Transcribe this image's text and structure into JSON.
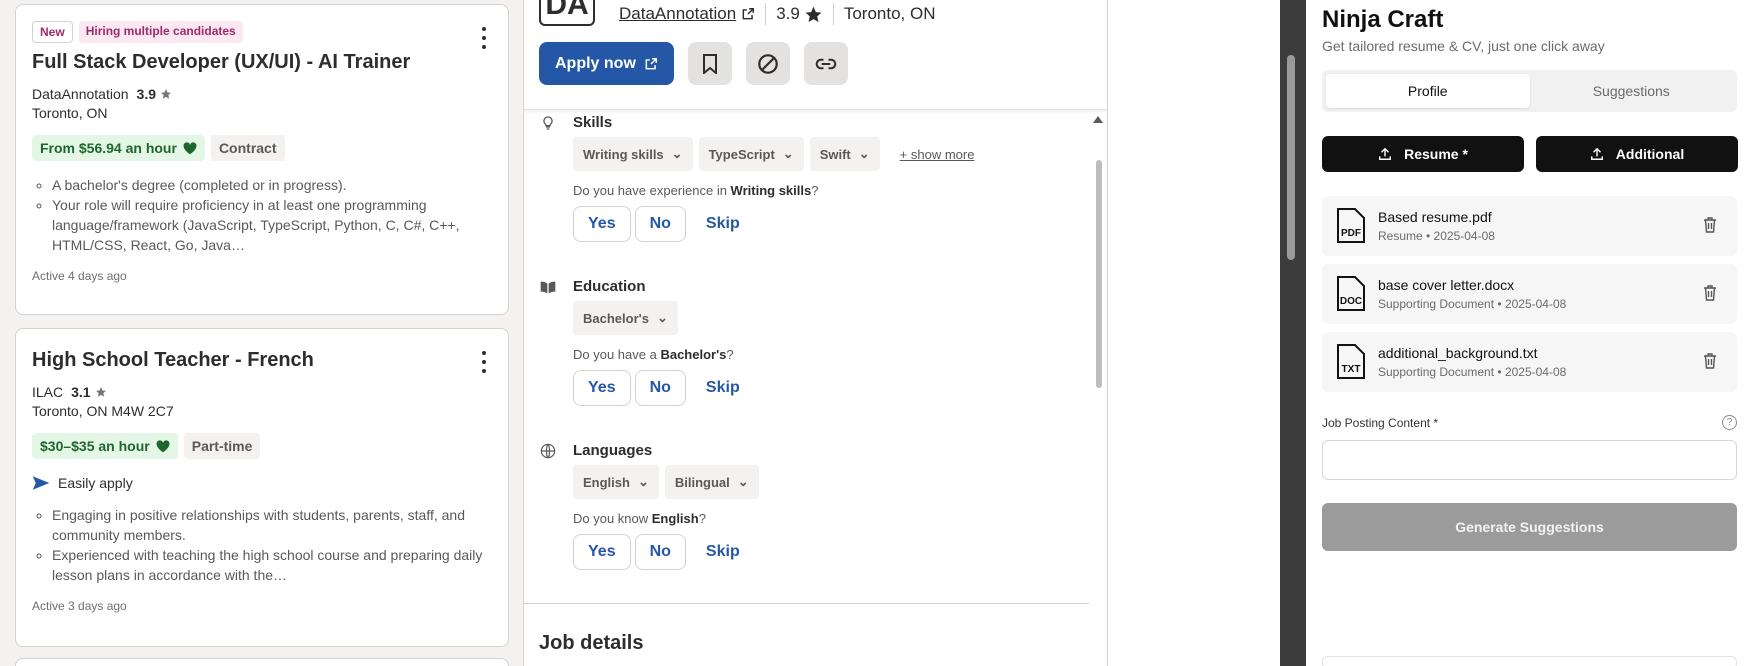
{
  "job_list": {
    "cards": [
      {
        "badges": [
          "New",
          "Hiring multiple candidates"
        ],
        "title": "Full Stack Developer (UX/UI) - AI Trainer",
        "company": "DataAnnotation",
        "rating": "3.9",
        "location": "Toronto, ON",
        "pay": "From $56.94 an hour",
        "job_type": "Contract",
        "bullets": [
          "A bachelor's degree (completed or in progress).",
          "Your role will require proficiency in at least one programming language/framework (JavaScript, TypeScript, Python, C, C#, C++, HTML/CSS, React, Go, Java…"
        ],
        "active": "Active 4 days ago"
      },
      {
        "title": "High School Teacher - French",
        "company": "ILAC",
        "rating": "3.1",
        "location": "Toronto, ON M4W 2C7",
        "pay": "$30–$35 an hour",
        "job_type": "Part-time",
        "easy_apply": "Easily apply",
        "bullets": [
          "Engaging in positive relationships with students, parents, staff, and community members.",
          "Experienced with teaching the high school course and preparing daily lesson plans in accordance with the…"
        ],
        "active": "Active 3 days ago"
      }
    ]
  },
  "detail": {
    "logo_text": "DA",
    "company": "DataAnnotation",
    "rating": "3.9",
    "location": "Toronto, ON",
    "apply_label": "Apply now",
    "skills": {
      "heading": "Skills",
      "chips": [
        "Writing skills",
        "TypeScript",
        "Swift"
      ],
      "show_more": "+ show more",
      "question_prefix": "Do you have experience in ",
      "question_subject": "Writing skills",
      "question_suffix": "?"
    },
    "education": {
      "heading": "Education",
      "chips": [
        "Bachelor's"
      ],
      "question_prefix": "Do you have a ",
      "question_subject": "Bachelor's",
      "question_suffix": "?"
    },
    "languages": {
      "heading": "Languages",
      "chips": [
        "English",
        "Bilingual"
      ],
      "question_prefix": "Do you know ",
      "question_subject": "English",
      "question_suffix": "?"
    },
    "yes_label": "Yes",
    "no_label": "No",
    "skip_label": "Skip",
    "job_details_title": "Job details"
  },
  "panel": {
    "title": "Ninja Craft",
    "subtitle": "Get tailored resume & CV, just one click away",
    "tabs": [
      "Profile",
      "Suggestions"
    ],
    "active_tab": "Profile",
    "resume_button": "Resume *",
    "additional_button": "Additional",
    "files": [
      {
        "icon": "PDF",
        "name": "Based resume.pdf",
        "meta": "Resume • 2025-04-08"
      },
      {
        "icon": "DOC",
        "name": "base cover letter.docx",
        "meta": "Supporting Document • 2025-04-08"
      },
      {
        "icon": "TXT",
        "name": "additional_background.txt",
        "meta": "Supporting Document • 2025-04-08"
      }
    ],
    "job_posting_label": "Job Posting Content *",
    "help_glyph": "?",
    "generate_button": "Generate Suggestions"
  },
  "colors": {
    "primary_blue": "#2557a7",
    "pay_green": "#1f662c",
    "badge_pink": "#9d2b6b",
    "panel_black": "#111111",
    "disabled_gray": "#9b9b9b"
  }
}
